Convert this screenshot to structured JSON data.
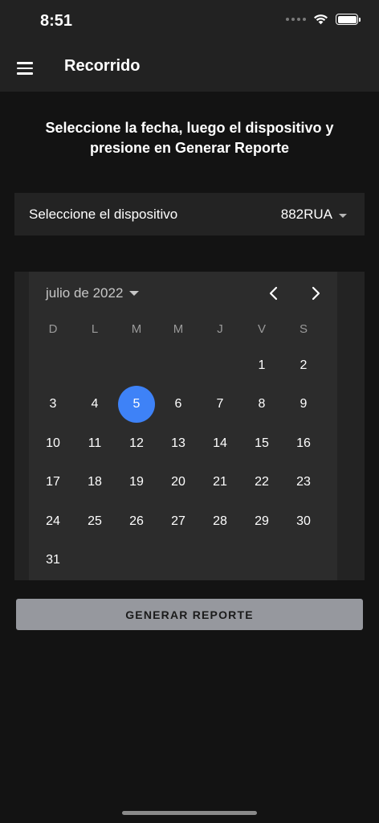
{
  "status_bar": {
    "time": "8:51",
    "signal_icon": "signal-dots-icon",
    "wifi_icon": "wifi-icon",
    "battery_icon": "battery-icon"
  },
  "app_bar": {
    "menu_icon": "hamburger-menu-icon",
    "title": "Recorrido"
  },
  "instructions": {
    "line1": "Seleccione la fecha, luego el dispositivo y",
    "line2": "presione en Generar Reporte"
  },
  "device": {
    "label": "Seleccione el dispositivo",
    "selected": "882RUA"
  },
  "calendar": {
    "month_label": "julio de 2022",
    "weekdays": [
      "D",
      "L",
      "M",
      "M",
      "J",
      "V",
      "S"
    ],
    "first_weekday_index": 5,
    "days_in_month": 31,
    "selected_day": 5,
    "selected_color": "#3e82f7"
  },
  "actions": {
    "generate_label": "GENERAR REPORTE"
  }
}
